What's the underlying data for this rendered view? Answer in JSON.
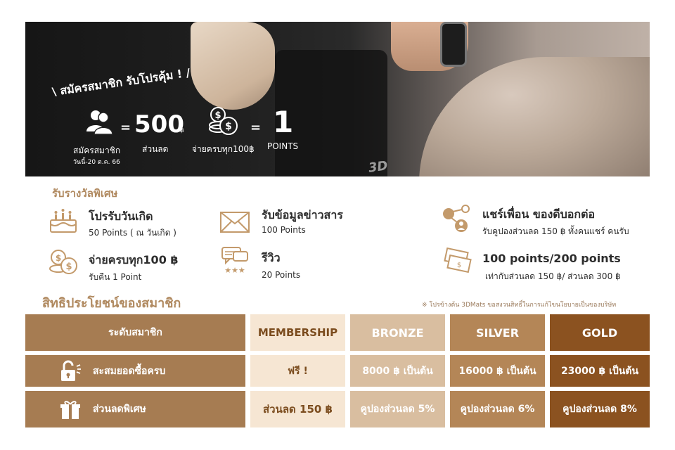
{
  "hero": {
    "headline": "\\ สมัครสมาชิก รับโปรคุ้ม ! /",
    "equals": "=",
    "amount": "500",
    "amount_unit": "฿",
    "member_caption": "สมัครสมาชิก",
    "member_subcaption": "วันนี้-20 ต.ค. 66",
    "discount_caption": "ส่วนลด",
    "spend_caption": "จ่ายครบทุก100฿",
    "points_value": "1",
    "points_caption": "POINTS",
    "icons": [
      "member-icon",
      "coins-icon"
    ],
    "mat_logo": "3D"
  },
  "rewards": {
    "title": "รับรางวัลพิเศษ",
    "items": [
      {
        "icon": "cake-icon",
        "title": "โปรรับวันเกิด",
        "desc": "50  Points ( ณ วันเกิด )"
      },
      {
        "icon": "coin-icon",
        "title": "จ่ายครบทุก100 ฿",
        "desc": "รับคืน 1 Point"
      },
      {
        "icon": "mail-icon",
        "title": "รับข้อมูลข่าวสาร",
        "desc": "100 Points"
      },
      {
        "icon": "review-icon",
        "title": "รีวิว",
        "desc": "20 Points"
      },
      {
        "icon": "share-icon",
        "title": "แชร์เพื่อน ของดีบอกต่อ",
        "desc": "รับคูปองส่วนลด 150 ฿ ทั้งคนแชร์ คนรับ"
      },
      {
        "icon": "cash-icon",
        "title": "100 points/200 points",
        "desc": "เท่ากับส่วนลด 150 ฿/ ส่วนลด 300 ฿"
      }
    ]
  },
  "benefits": {
    "title": "สิทธิประโยชน์ของสมาชิก",
    "note": "※ โปรข้างต้น 3DMats ขอสงวนสิทธิ์ในการแก้ไขนโยบายเป็นของบริษัท",
    "headers": [
      "ระดับสมาชิก",
      "MEMBERSHIP",
      "BRONZE",
      "SILVER",
      "GOLD"
    ],
    "rows": [
      {
        "icon": "unlock-icon",
        "label": "สะสมยอดซื้อครบ",
        "values": [
          "ฟรี !",
          "8000 ฿ เป็นต้น",
          "16000 ฿ เป็นต้น",
          "23000 ฿ เป็นต้น"
        ]
      },
      {
        "icon": "gift-icon",
        "label": "ส่วนลดพิเศษ",
        "values": [
          "ส่วนลด 150 ฿",
          "คูปองส่วนลด 5%",
          "คูปองส่วนลด 6%",
          "คูปองส่วนลด 8%"
        ]
      }
    ]
  },
  "colors": {
    "accent_gold": "#b0895f",
    "tier_label": "#a67c52",
    "tier_membership": "#f6e6d3",
    "tier_bronze": "#d9bea0",
    "tier_silver": "#b48657",
    "tier_gold": "#8b5220"
  }
}
